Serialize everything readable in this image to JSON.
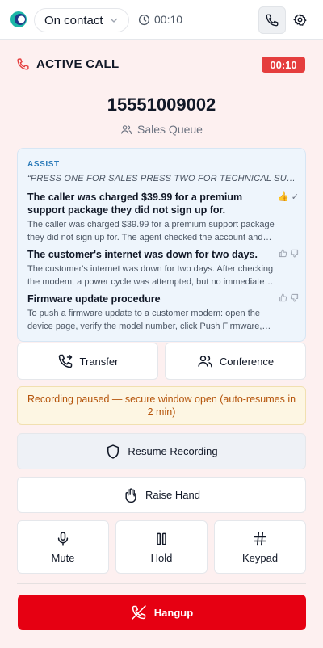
{
  "header": {
    "status_label": "On contact",
    "timer": "00:10"
  },
  "call": {
    "state_label": "ACTIVE CALL",
    "timer": "00:10",
    "number": "15551009002",
    "queue": "Sales Queue"
  },
  "assist": {
    "title": "ASSIST",
    "quote": "“PRESS ONE FOR SALES PRESS TWO FOR TECHNICAL SUPPORT…",
    "items": [
      {
        "title": "The caller was charged $39.99 for a premium support package they did not sign up for.",
        "body_line1": "The caller was charged $39.99 for a premium support package",
        "body_line2": "they did not sign up for. The agent checked the account and…",
        "feedback": "rated-up"
      },
      {
        "title": "The customer's internet was down for two days.",
        "body_line1": "The customer's internet was down for two days. After checking",
        "body_line2": "the modem, a power cycle was attempted, but no immediate…",
        "feedback": "none"
      },
      {
        "title": "Firmware update procedure",
        "body_line1": "To push a firmware update to a customer modem: open the",
        "body_line2": "device page, verify the model number, click Push Firmware,…",
        "feedback": "none"
      }
    ]
  },
  "actions": {
    "transfer": "Transfer",
    "conference": "Conference",
    "notice": "Recording paused — secure window open (auto-resumes in 2 min)",
    "resume": "Resume Recording",
    "raise_hand": "Raise Hand",
    "mute": "Mute",
    "hold": "Hold",
    "keypad": "Keypad",
    "hangup": "Hangup"
  },
  "colors": {
    "accent_red": "#e60012",
    "timer_badge": "#e53e3e",
    "assist_blue": "#2b7bb9",
    "notice_text": "#b45309",
    "background": "#fdf0f0"
  },
  "icons": {
    "logo": "app-logo",
    "status_chevron": "chevron-down-icon",
    "timer": "clock-icon",
    "phone_tab": "phone-icon",
    "settings": "gear-icon",
    "active_call": "phone-icon",
    "queue": "users-icon",
    "thumbs_up": "thumbs-up-icon",
    "thumbs_down": "thumbs-down-icon",
    "transfer": "phone-forward-icon",
    "conference": "users-icon",
    "resume": "shield-icon",
    "raise_hand": "hand-icon",
    "mute": "microphone-icon",
    "hold": "pause-icon",
    "keypad": "hash-icon",
    "hangup": "phone-off-icon"
  }
}
